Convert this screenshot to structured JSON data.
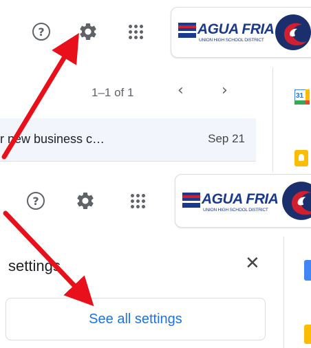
{
  "top": {
    "pagination": "1–1 of 1",
    "email": {
      "subject": "r new business c…",
      "date": "Sep 21"
    },
    "account": {
      "logo_text": "AGUA FRIA",
      "logo_subtext": "UNION HIGH SCHOOL DISTRICT"
    }
  },
  "bottom": {
    "account": {
      "logo_text": "AGUA FRIA",
      "logo_subtext": "UNION HIGH SCHOOL DISTRICT"
    },
    "settings_title": "settings",
    "close_symbol": "✕",
    "see_all_settings": "See all settings"
  },
  "icons": {
    "help": "help-circle-icon",
    "settings": "gear-icon",
    "apps": "apps-grid-icon",
    "chevron_left": "‹",
    "chevron_right": "›",
    "calendar_number": "31"
  },
  "colors": {
    "arrow": "#e8101a",
    "link_blue": "#1a73e8",
    "logo_blue": "#1a3a8f",
    "logo_red": "#d0202f",
    "row_bg": "#f2f6fc"
  }
}
